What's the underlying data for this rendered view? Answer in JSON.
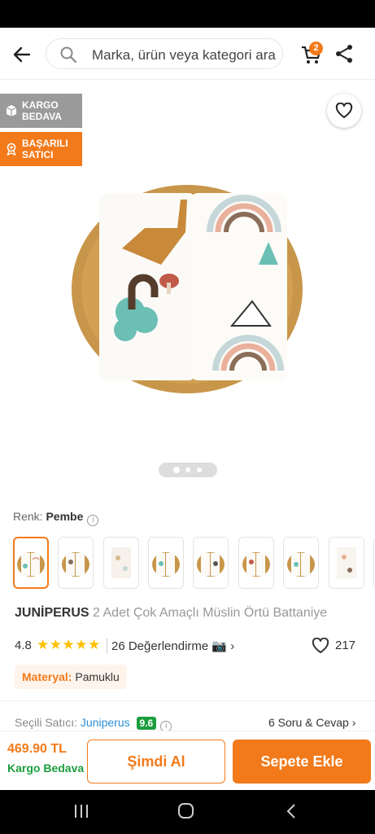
{
  "header": {
    "search_placeholder": "Marka, ürün veya kategori ara",
    "cart_count": "2",
    "icons": [
      "back-arrow-icon",
      "search-icon",
      "cart-icon",
      "share-icon"
    ]
  },
  "badges": {
    "cargo": "KARGO BEDAVA",
    "seller": "BAŞARILI SATICI"
  },
  "gallery": {
    "active_index": 0,
    "total": 3
  },
  "color": {
    "label": "Renk:",
    "value": "Pembe"
  },
  "product": {
    "brand": "JUNİPERUS",
    "name": "2 Adet Çok Amaçlı Müslin Örtü Battaniye",
    "rating": "4.8",
    "stars": "★★★★★",
    "reviews": "26 Değerlendirme",
    "favorites": "217"
  },
  "material": {
    "label": "Materyal:",
    "value": "Pamuklu"
  },
  "seller": {
    "label": "Seçili Satıcı:",
    "name": "Juniperus",
    "score": "9.6",
    "qa": "6 Soru & Cevap"
  },
  "purchase": {
    "price": "469.90 TL",
    "shipping": "Kargo Bedava",
    "buy_now": "Şimdi Al",
    "add_to_cart": "Sepete Ekle"
  },
  "colors": {
    "accent": "#f27a1a",
    "success": "#1b9e3e",
    "link": "#2c8fd4",
    "badge_gray": "#9a9a9a"
  }
}
